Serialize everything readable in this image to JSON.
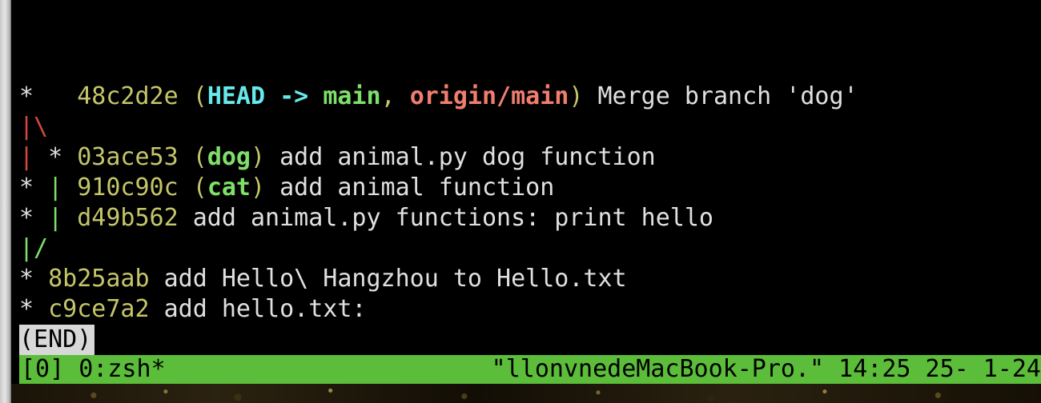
{
  "window": {
    "app": "Terminal (tmux + zsh) — git log --graph"
  },
  "log": {
    "line1": {
      "graph": "*   ",
      "hash": "48c2d2e",
      "open": " (",
      "head": "HEAD -> ",
      "ref_main": "main",
      "sep": ", ",
      "ref_origin": "origin/main",
      "close": ")",
      "message": " Merge branch 'dog'"
    },
    "line2": {
      "graph": "|\\"
    },
    "line3": {
      "graph_a": "|",
      "graph_b": " * ",
      "hash": "03ace53",
      "open": " (",
      "ref": "dog",
      "close": ")",
      "message": " add animal.py dog function"
    },
    "line4": {
      "graph_a": "* ",
      "graph_b": "| ",
      "hash": "910c90c",
      "open": " (",
      "ref": "cat",
      "close": ")",
      "message": " add animal function"
    },
    "line5": {
      "graph_a": "* ",
      "graph_b": "| ",
      "hash": "d49b562",
      "message": " add animal.py functions: print hello"
    },
    "line6": {
      "graph": "|/"
    },
    "line7": {
      "graph": "* ",
      "hash": "8b25aab",
      "message": " add Hello\\ Hangzhou to Hello.txt"
    },
    "line8": {
      "graph": "* ",
      "hash": "c9ce7a2",
      "message": " add hello.txt:"
    },
    "end_marker": "(END)"
  },
  "tmux": {
    "session_window": "[0] 0:zsh*",
    "status_right": "\"llonvnedeMacBook-Pro.\" 14:25 25- 1-24",
    "bar_color": "#5bbd3a"
  },
  "colors": {
    "hash": "#c5c56a",
    "head": "#67e8ea",
    "local_branch": "#7ee06a",
    "remote_branch": "#f07e6e",
    "graph_red": "#d24a3c",
    "graph_green": "#7ee06a",
    "text": "#e0e0e0",
    "background": "#000000"
  }
}
